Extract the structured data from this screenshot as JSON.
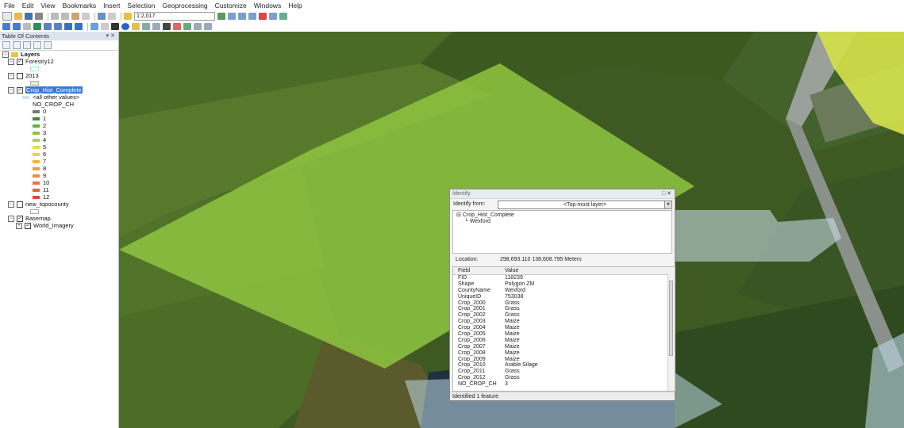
{
  "menu": [
    "File",
    "Edit",
    "View",
    "Bookmarks",
    "Insert",
    "Selection",
    "Geoprocessing",
    "Customize",
    "Windows",
    "Help"
  ],
  "toolbar": {
    "scale": "1:2,017"
  },
  "toc": {
    "title": "Table Of Contents",
    "root": "Layers",
    "forestry": "Forestry12",
    "y2013": "2013",
    "crop_layer": "Crop_Hist_Complete",
    "all_other": "<all other values>",
    "field": "NO_CROP_CH",
    "classes": [
      {
        "label": "0",
        "color": "#6f7f6f"
      },
      {
        "label": "1",
        "color": "#3a8f3a"
      },
      {
        "label": "2",
        "color": "#6aae3c"
      },
      {
        "label": "3",
        "color": "#8cc23f"
      },
      {
        "label": "4",
        "color": "#b3d13e"
      },
      {
        "label": "5",
        "color": "#e2df3e"
      },
      {
        "label": "6",
        "color": "#f1cf44"
      },
      {
        "label": "7",
        "color": "#f4b449"
      },
      {
        "label": "8",
        "color": "#f09a47"
      },
      {
        "label": "9",
        "color": "#ee8546"
      },
      {
        "label": "10",
        "color": "#ea7044"
      },
      {
        "label": "11",
        "color": "#e55b40"
      },
      {
        "label": "12",
        "color": "#df453c"
      }
    ],
    "topo": "new_topocounty",
    "basemap": "Basemap",
    "imagery": "World_Imagery"
  },
  "identify": {
    "title": "Identify",
    "from_label": "Identify from:",
    "from_value": "<Top-most layer>",
    "tree_layer": "Crop_Hist_Complete",
    "tree_feature": "Wexford",
    "location_label": "Location:",
    "location_value": "298,693.110  138,608.795 Meters",
    "col_field": "Field",
    "col_value": "Value",
    "rows": [
      {
        "f": "FID",
        "v": "118239"
      },
      {
        "f": "Shape",
        "v": "Polygon ZM"
      },
      {
        "f": "CountyName",
        "v": "Wexford"
      },
      {
        "f": "UniqueID",
        "v": "753038"
      },
      {
        "f": "Crop_2000",
        "v": "Grass"
      },
      {
        "f": "Crop_2001",
        "v": "Grass"
      },
      {
        "f": "Crop_2002",
        "v": "Grass"
      },
      {
        "f": "Crop_2003",
        "v": "Maize"
      },
      {
        "f": "Crop_2004",
        "v": "Maize"
      },
      {
        "f": "Crop_2005",
        "v": "Maize"
      },
      {
        "f": "Crop_2006",
        "v": "Maize"
      },
      {
        "f": "Crop_2007",
        "v": "Maize"
      },
      {
        "f": "Crop_2008",
        "v": "Maize"
      },
      {
        "f": "Crop_2009",
        "v": "Maize"
      },
      {
        "f": "Crop_2010",
        "v": "Arable Silage"
      },
      {
        "f": "Crop_2011",
        "v": "Grass"
      },
      {
        "f": "Crop_2012",
        "v": "Grass"
      },
      {
        "f": "NO_CROP_CH",
        "v": "3"
      }
    ],
    "status": "Identified 1 feature"
  },
  "colors": {
    "polygon": "#8cc23f",
    "selection": "#3a78d8"
  }
}
